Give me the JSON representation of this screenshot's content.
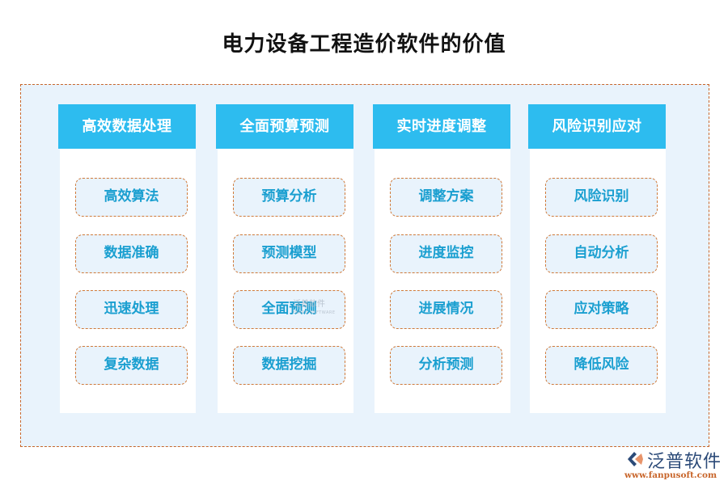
{
  "title": "电力设备工程造价软件的价值",
  "columns": [
    {
      "header": "高效数据处理",
      "items": [
        "高效算法",
        "数据准确",
        "迅速处理",
        "复杂数据"
      ]
    },
    {
      "header": "全面预算预测",
      "items": [
        "预算分析",
        "预测模型",
        "全面预测",
        "数据挖掘"
      ]
    },
    {
      "header": "实时进度调整",
      "items": [
        "调整方案",
        "进度监控",
        "进展情况",
        "分析预测"
      ]
    },
    {
      "header": "风险识别应对",
      "items": [
        "风险识别",
        "自动分析",
        "应对策略",
        "降低风险"
      ]
    }
  ],
  "watermark": {
    "text": "泛普软件",
    "sub": "FANPU SOFTWARE"
  },
  "logo": {
    "name": "泛普软件",
    "url": "www.fanpusoft.com",
    "icon": "fanpu-logo-icon"
  },
  "colors": {
    "header_bg": "#2dbcef",
    "pill_text": "#1a9fd0",
    "dash_border": "#c8652a",
    "frame_bg": "#e9f3fc"
  }
}
